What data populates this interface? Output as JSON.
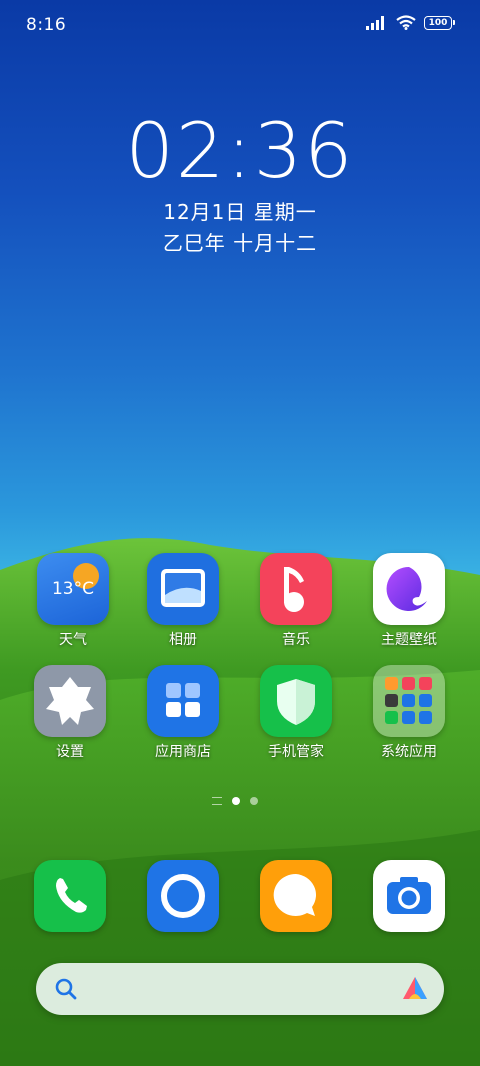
{
  "status_bar": {
    "time": "8:16",
    "battery": "100"
  },
  "clock": {
    "time": "02:36",
    "date": "12月1日 星期一",
    "lunar": "乙巳年 十月十二"
  },
  "apps": [
    {
      "name": "weather",
      "label": "天气",
      "temp": "13°C"
    },
    {
      "name": "gallery",
      "label": "相册"
    },
    {
      "name": "music",
      "label": "音乐"
    },
    {
      "name": "themes",
      "label": "主题壁纸"
    },
    {
      "name": "settings",
      "label": "设置"
    },
    {
      "name": "app-store",
      "label": "应用商店"
    },
    {
      "name": "security",
      "label": "手机管家"
    },
    {
      "name": "system-apps-folder",
      "label": "系统应用"
    }
  ],
  "dock": [
    {
      "name": "phone",
      "icon": "phone-icon"
    },
    {
      "name": "browser",
      "icon": "browser-icon"
    },
    {
      "name": "messages",
      "icon": "message-icon"
    },
    {
      "name": "camera",
      "icon": "camera-icon"
    }
  ],
  "page_indicator": {
    "pages": 2,
    "current": 1
  },
  "search": {
    "icon": "search-icon",
    "assistant_icon": "ai-assistant-icon"
  },
  "colors": {
    "sky_top": "#0a3aa6",
    "grass": "#2f8a1c"
  }
}
